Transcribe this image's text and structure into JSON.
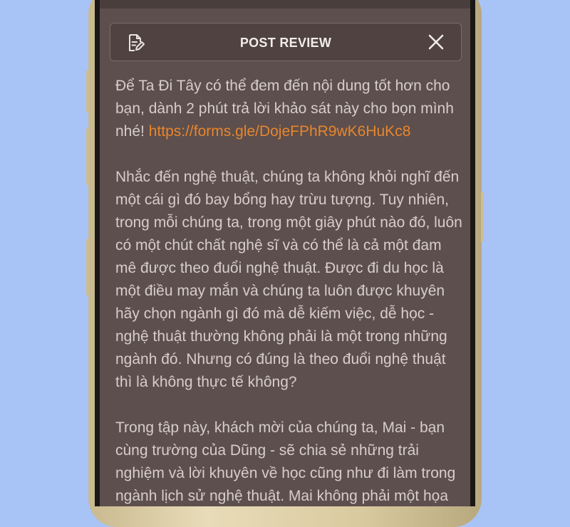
{
  "header": {
    "title": "POST REVIEW",
    "icons": {
      "left": "document-edit-icon",
      "right": "close-icon"
    }
  },
  "content": {
    "paragraph1_text": "Để Ta Đi Tây có thể đem đến nội dung tốt hơn cho bạn, dành 2 phút trả lời khảo sát này cho bọn mình nhé! ",
    "paragraph1_link": "https://forms.gle/DojeFPhR9wK6HuKc8",
    "paragraph2": "Nhắc đến nghệ thuật, chúng ta không khỏi nghĩ đến một cái gì đó bay bổng hay trừu tượng. Tuy nhiên, trong mỗi chúng ta, trong một giây phút nào đó, luôn có một chút chất nghệ sĩ và có thể là cả một đam mê được theo đuổi nghệ thuật. Được đi du học là một điều may mắn và chúng ta luôn được khuyên hãy chọn ngành gì đó mà dễ kiếm việc, dễ học - nghệ thuật thường không phải là một trong những ngành đó. Nhưng có đúng là theo đuổi nghệ thuật thì là không thực tế không?",
    "paragraph3": "Trong tập này, khách mời của chúng ta, Mai - bạn cùng trường của Dũng - sẽ chia sẻ những trải nghiệm và lời khuyên về học cũng như đi làm trong ngành lịch sử nghệ thuật. Mai không phải một họa"
  },
  "colors": {
    "background": "#a8c4f7",
    "screen": "#5d4f4d",
    "text": "#d7cdca",
    "link": "#e8862e"
  }
}
